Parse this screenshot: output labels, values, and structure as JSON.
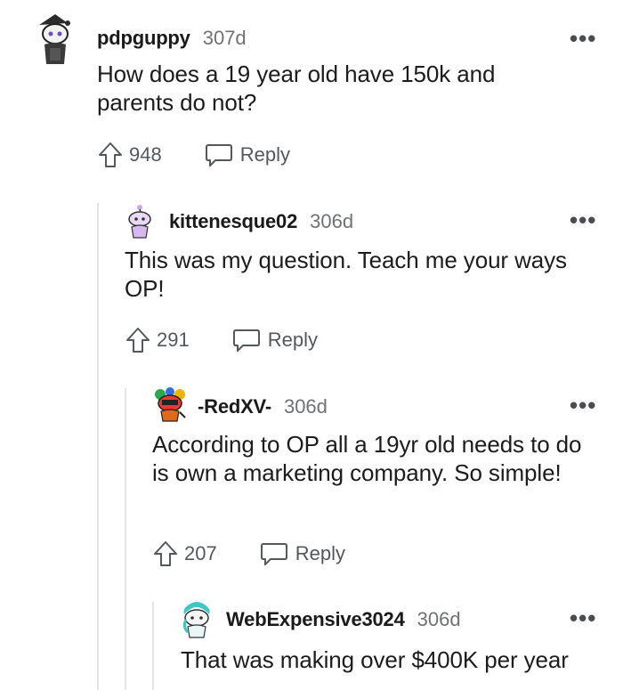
{
  "comments": [
    {
      "username": "pdpguppy",
      "age": "307d",
      "body": "How does a 19 year old have 150k and parents do not?",
      "votes": "948",
      "reply_label": "Reply",
      "more": "•••",
      "avatar_icon": "snoo-wizard-avatar-icon"
    },
    {
      "username": "kittenesque02",
      "age": "306d",
      "body": "This was my question. Teach me your ways OP!",
      "votes": "291",
      "reply_label": "Reply",
      "more": "•••",
      "avatar_icon": "snoo-pink-avatar-icon"
    },
    {
      "username": "-RedXV-",
      "age": "306d",
      "body": "According to OP all a 19yr old needs to do is own a marketing company. So simple!",
      "votes": "207",
      "reply_label": "Reply",
      "more": "•••",
      "avatar_icon": "snoo-colorful-avatar-icon"
    },
    {
      "username": "WebExpensive3024",
      "age": "306d",
      "body": "That was making over $400K per year",
      "more": "•••",
      "avatar_icon": "snoo-teal-avatar-icon"
    }
  ],
  "colors": {
    "thread_line": "#e4e4e6",
    "meta_text": "#6f7173"
  }
}
